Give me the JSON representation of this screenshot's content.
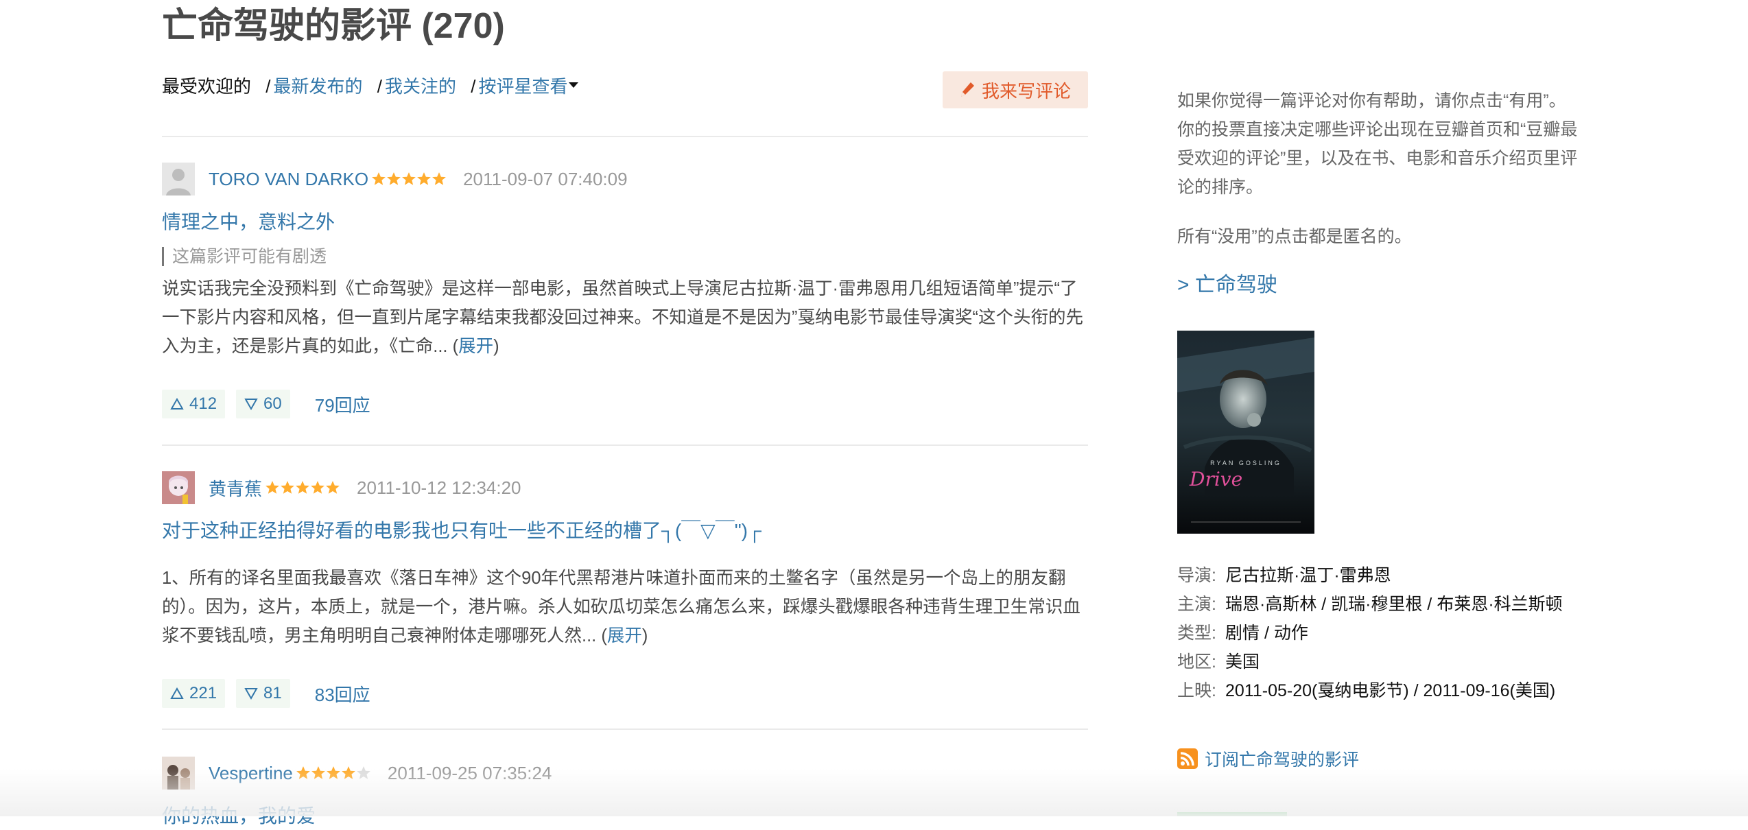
{
  "page": {
    "title": "亡命驾驶的影评 (270)"
  },
  "sort": {
    "popular": "最受欢迎的",
    "sep": "/",
    "latest": "最新发布的",
    "following": "我关注的",
    "by_rating": "按评星查看"
  },
  "write_button": {
    "label": "我来写评论"
  },
  "reviews": [
    {
      "author": "TORO VAN DARKO",
      "rating": 5,
      "time": "2011-09-07 07:40:09",
      "title": "情理之中，意料之外",
      "spoiler": "这篇影评可能有剧透",
      "body": "说实话我完全没预料到《亡命驾驶》是这样一部电影，虽然首映式上导演尼古拉斯·温丁·雷弗恩用几组短语简单”提示“了一下影片内容和风格，但一直到片尾字幕结束我都没回过神来。不知道是不是因为”戛纳电影节最佳导演奖“这个头衔的先入为主，还是影片真的如此，《亡命... (",
      "expand": "展开",
      "close": ")",
      "up": "412",
      "down": "60",
      "replies": "79回应"
    },
    {
      "author": "黄青蕉",
      "rating": 5,
      "time": "2011-10-12 12:34:20",
      "title": "对于这种正经拍得好看的电影我也只有吐一些不正经的槽了┐(￣▽￣\")┌",
      "body": "1、所有的译名里面我最喜欢《落日车神》这个90年代黑帮港片味道扑面而来的土鳖名字（虽然是另一个岛上的朋友翻的）。因为，这片，本质上，就是一个，港片嘛。杀人如砍瓜切菜怎么痛怎么来，踩爆头戳爆眼各种违背生理卫生常识血浆不要钱乱喷，男主角明明自己衰神附体走哪哪死人然... (",
      "expand": "展开",
      "close": ")",
      "up": "221",
      "down": "81",
      "replies": "83回应"
    },
    {
      "author": "Vespertine",
      "rating": 4,
      "time": "2011-09-25 07:35:24",
      "title": "你的热血，我的爱"
    }
  ],
  "sidebar": {
    "tip": "如果你觉得一篇评论对你有帮助，请你点击“有用”。你的投票直接决定哪些评论出现在豆瓣首页和“豆瓣最受欢迎的评论”里，以及在书、电影和音乐介绍页里评论的排序。",
    "anon": "所有“没用”的点击都是匿名的。",
    "movie_link": "> 亡命驾驶",
    "poster_credit": "RYAN GOSLING",
    "poster_title": "Drive",
    "info": [
      {
        "k": "导演:",
        "v": "尼古拉斯·温丁·雷弗恩"
      },
      {
        "k": "主演:",
        "v": "瑞恩·高斯林 / 凯瑞·穆里根 / 布莱恩·科兰斯顿"
      },
      {
        "k": "类型:",
        "v": "剧情 / 动作"
      },
      {
        "k": "地区:",
        "v": "美国"
      },
      {
        "k": "上映:",
        "v": "2011-05-20(戛纳电影节) / 2011-09-16(美国)"
      }
    ],
    "subscribe": "订阅亡命驾驶的影评"
  },
  "colors": {
    "link": "#3377aa",
    "star": "#ffac2d",
    "accent": "#e15a2a",
    "vote_bg": "#f2f8f2"
  },
  "icons": {
    "write": "pencil-icon",
    "up": "triangle-up-icon",
    "down": "triangle-down-icon",
    "rss": "rss-icon",
    "star": "star-icon"
  }
}
